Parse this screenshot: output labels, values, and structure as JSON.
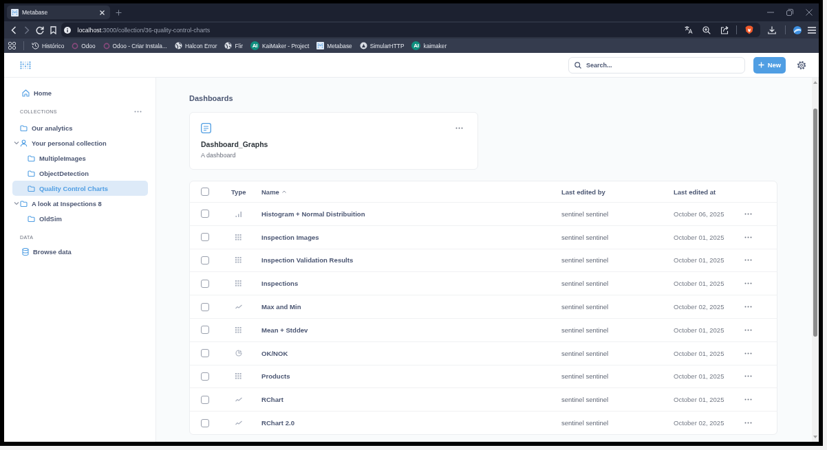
{
  "browser": {
    "tabs": [
      {
        "title": "Metabase",
        "selected": true
      }
    ],
    "url": {
      "host": "localhost",
      "path": ":3000/collection/36-quality-control-charts"
    },
    "bookmarks": [
      {
        "label": "Histórico",
        "kind": "history"
      },
      {
        "label": "Odoo",
        "kind": "ring"
      },
      {
        "label": "Odoo - Criar Instala...",
        "kind": "ring"
      },
      {
        "label": "Halcon Error",
        "kind": "globe"
      },
      {
        "label": "Flir",
        "kind": "globe"
      },
      {
        "label": "KaiMaker - Project",
        "kind": "letters",
        "badge": "AI"
      },
      {
        "label": "Metabase",
        "kind": "dots"
      },
      {
        "label": "SimularHTTP",
        "kind": "round"
      },
      {
        "label": "kaimaker",
        "kind": "letters",
        "badge": "AI"
      }
    ]
  },
  "header": {
    "search": {
      "placeholder": "Search..."
    },
    "new_button": "New"
  },
  "sidebar": {
    "home": "Home",
    "collections_heading": "COLLECTIONS",
    "collections": [
      {
        "label": "Our analytics",
        "kind": "folder",
        "selected": false
      },
      {
        "label": "Your personal collection",
        "kind": "person",
        "selected": false,
        "expanded": true,
        "children": [
          {
            "label": "MultipleImages",
            "kind": "folder",
            "selected": false
          },
          {
            "label": "ObjectDetection",
            "kind": "folder",
            "selected": false
          },
          {
            "label": "Quality Control Charts",
            "kind": "folder",
            "selected": true
          }
        ]
      },
      {
        "label": "A look at Inspections 8",
        "kind": "folder",
        "selected": false,
        "expanded": true,
        "children": [
          {
            "label": "OldSim",
            "kind": "folder",
            "selected": false
          }
        ]
      }
    ],
    "data_heading": "DATA",
    "data_items": [
      {
        "label": "Browse data"
      }
    ]
  },
  "main": {
    "section_title": "Dashboards",
    "dashboard_cards": [
      {
        "title": "Dashboard_Graphs",
        "description": "A dashboard"
      }
    ],
    "table": {
      "select_all": {
        "checked": false
      },
      "columns": [
        {
          "label": "Type",
          "sorted": false
        },
        {
          "label": "Name",
          "sorted": true
        },
        {
          "label": "Last edited by",
          "sorted": false
        },
        {
          "label": "Last edited at",
          "sorted": false
        }
      ],
      "rows": [
        {
          "kind": "bar",
          "name": "Histogram + Normal Distribuition",
          "edited_by": "sentinel sentinel",
          "edited_at": "October 06, 2025",
          "checked": false
        },
        {
          "kind": "table",
          "name": "Inspection Images",
          "edited_by": "sentinel sentinel",
          "edited_at": "October 01, 2025",
          "checked": false
        },
        {
          "kind": "table",
          "name": "Inspection Validation Results",
          "edited_by": "sentinel sentinel",
          "edited_at": "October 01, 2025",
          "checked": false
        },
        {
          "kind": "table",
          "name": "Inspections",
          "edited_by": "sentinel sentinel",
          "edited_at": "October 01, 2025",
          "checked": false
        },
        {
          "kind": "line",
          "name": "Max and Min",
          "edited_by": "sentinel sentinel",
          "edited_at": "October 02, 2025",
          "checked": false
        },
        {
          "kind": "table",
          "name": "Mean + Stddev",
          "edited_by": "sentinel sentinel",
          "edited_at": "October 01, 2025",
          "checked": false
        },
        {
          "kind": "pie",
          "name": "OK/NOK",
          "edited_by": "sentinel sentinel",
          "edited_at": "October 01, 2025",
          "checked": false
        },
        {
          "kind": "table",
          "name": "Products",
          "edited_by": "sentinel sentinel",
          "edited_at": "October 01, 2025",
          "checked": false
        },
        {
          "kind": "line",
          "name": "RChart",
          "edited_by": "sentinel sentinel",
          "edited_at": "October 01, 2025",
          "checked": false
        },
        {
          "kind": "line",
          "name": "RChart 2.0",
          "edited_by": "sentinel sentinel",
          "edited_at": "October 02, 2025",
          "checked": false
        }
      ]
    }
  }
}
